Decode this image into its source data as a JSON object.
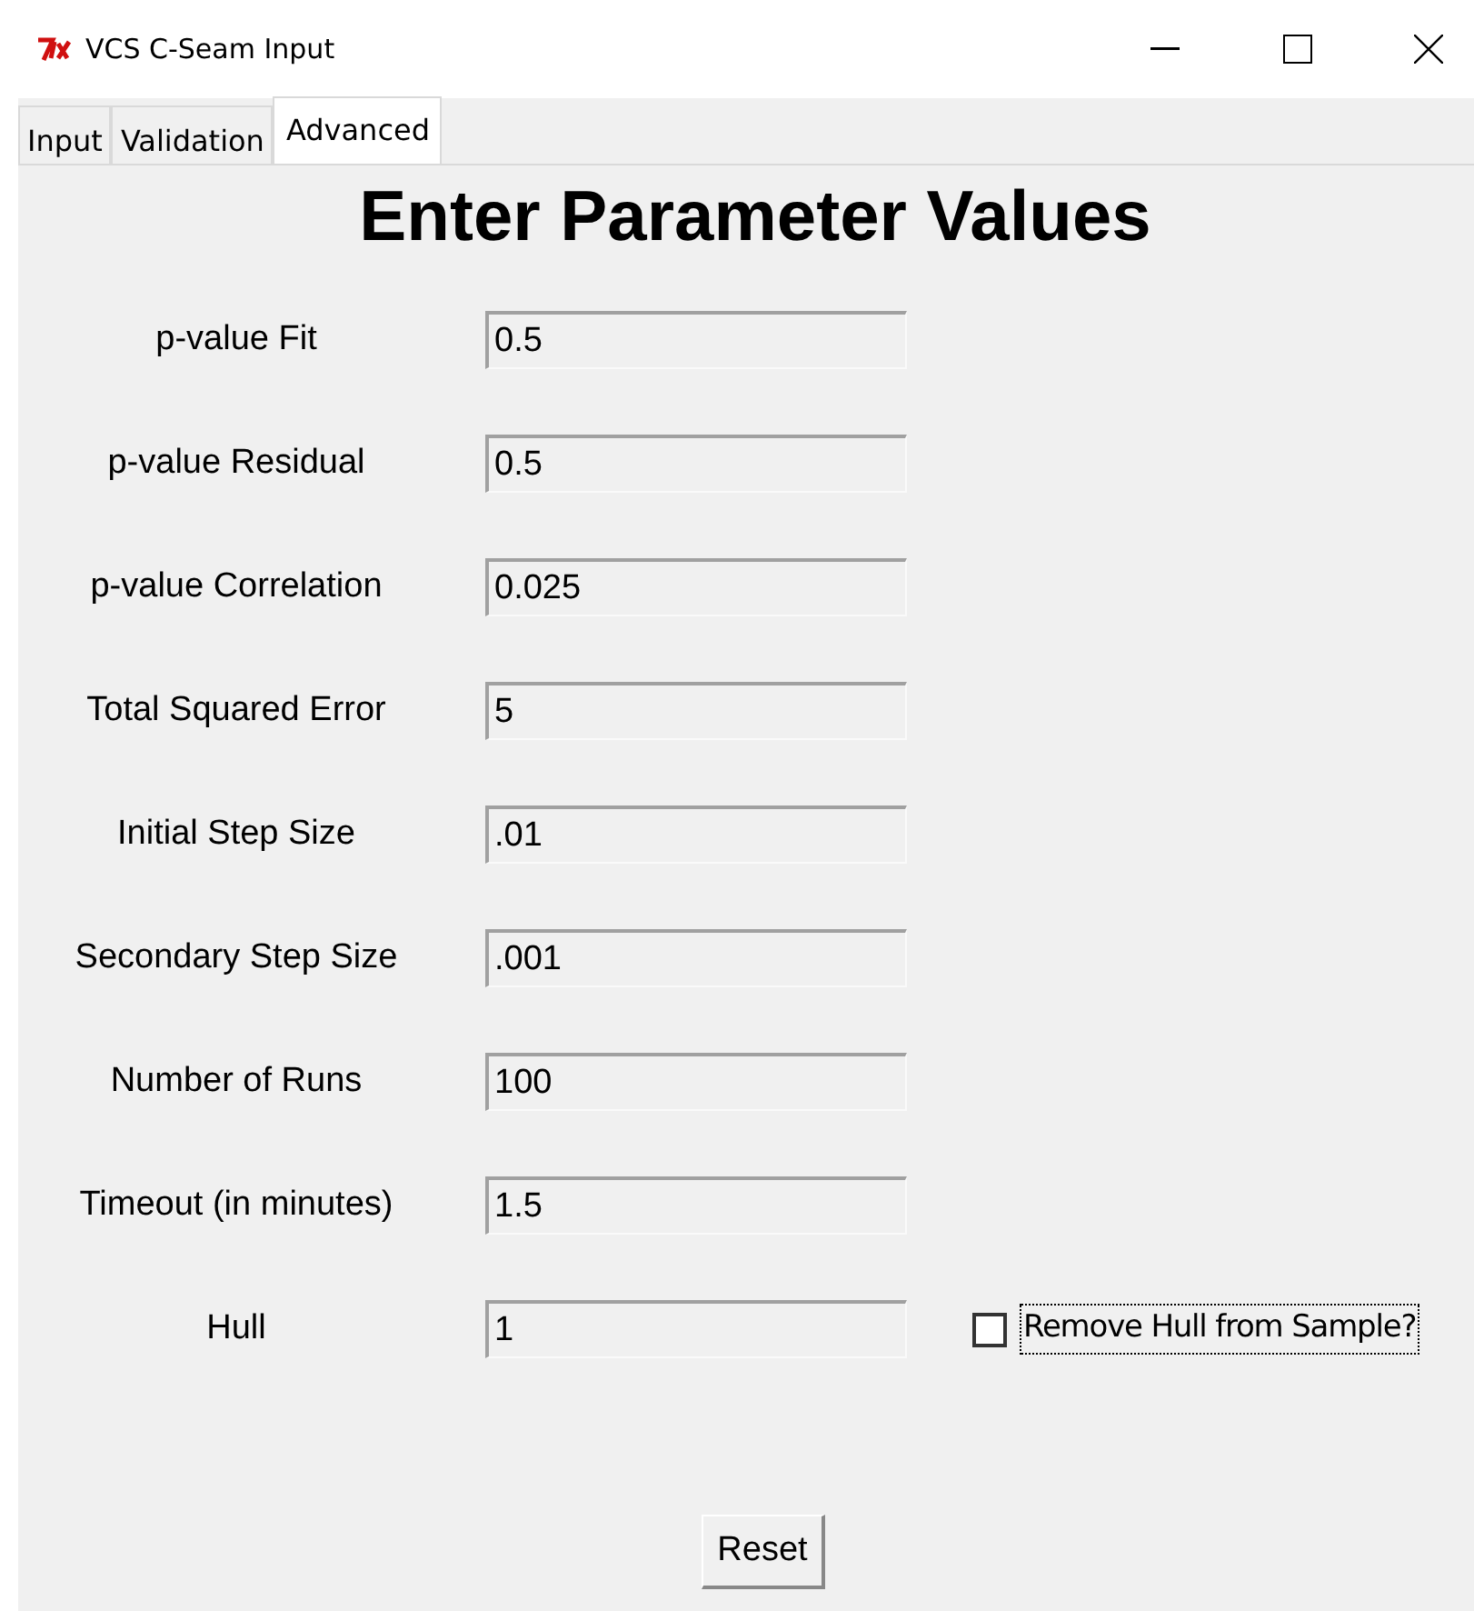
{
  "window": {
    "title": "VCS C-Seam Input"
  },
  "tabs": [
    {
      "label": "Input",
      "selected": false
    },
    {
      "label": "Validation",
      "selected": false
    },
    {
      "label": "Advanced",
      "selected": true
    }
  ],
  "heading": "Enter Parameter Values",
  "fields": [
    {
      "label": "p-value Fit",
      "value": "0.5"
    },
    {
      "label": "p-value Residual",
      "value": "0.5"
    },
    {
      "label": "p-value Correlation",
      "value": "0.025"
    },
    {
      "label": "Total Squared Error",
      "value": "5"
    },
    {
      "label": "Initial Step Size",
      "value": ".01"
    },
    {
      "label": "Secondary Step Size",
      "value": ".001"
    },
    {
      "label": "Number of Runs",
      "value": "100"
    },
    {
      "label": "Timeout (in minutes)",
      "value": "1.5"
    },
    {
      "label": "Hull",
      "value": "1",
      "checkbox": {
        "label": "Remove Hull from Sample?",
        "checked": false
      }
    }
  ],
  "reset_button": "Reset"
}
